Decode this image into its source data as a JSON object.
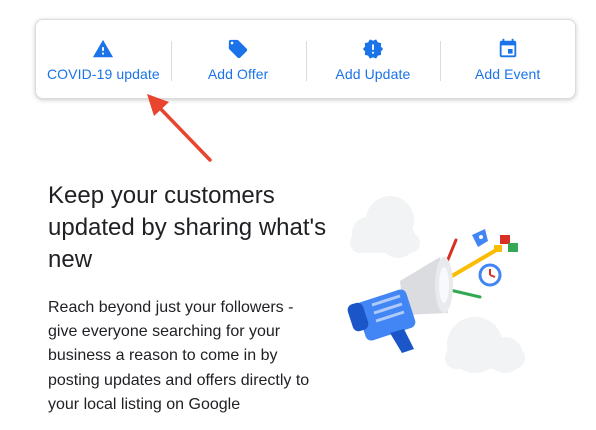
{
  "toolbar": {
    "items": [
      {
        "label": "COVID-19 update",
        "icon": "warning-icon"
      },
      {
        "label": "Add Offer",
        "icon": "tag-icon"
      },
      {
        "label": "Add Update",
        "icon": "badge-alert-icon"
      },
      {
        "label": "Add Event",
        "icon": "calendar-icon"
      }
    ]
  },
  "content": {
    "headline": "Keep your customers updated by sharing what's new",
    "body": "Reach beyond just your followers - give everyone searching for your business a reason to come in by posting updates and offers directly to your local listing on Google"
  },
  "colors": {
    "accent": "#1a73e8",
    "annotation_arrow": "#e8442e",
    "text": "#202124"
  }
}
